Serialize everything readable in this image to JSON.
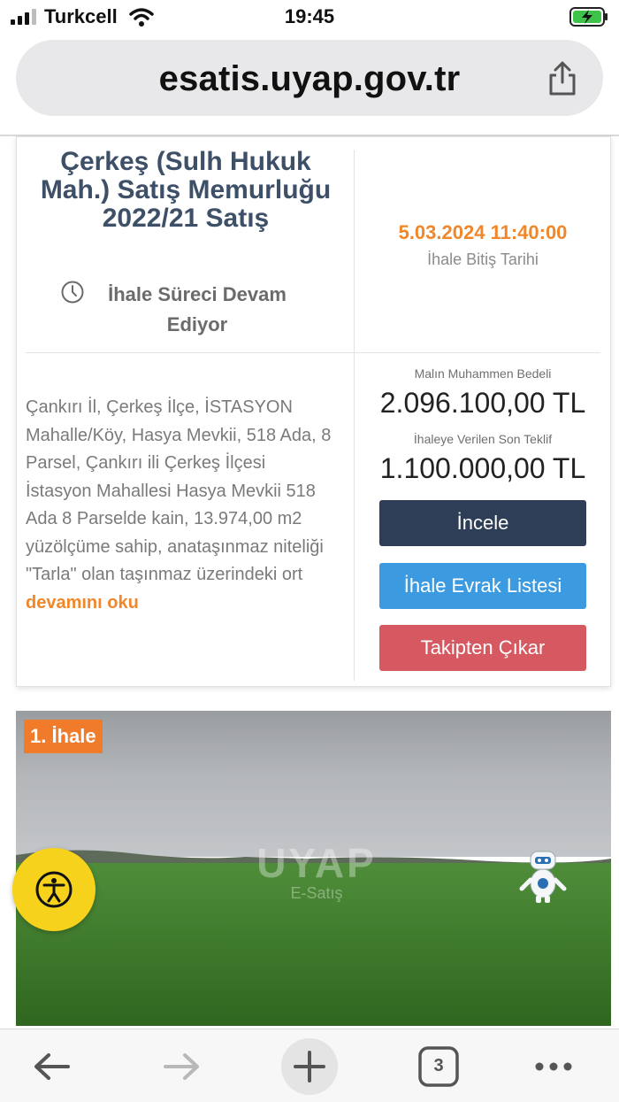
{
  "status_bar": {
    "carrier": "Turkcell",
    "time": "19:45"
  },
  "browser": {
    "url": "esatis.uyap.gov.tr",
    "tab_count": "3"
  },
  "listing": {
    "title": "Çerkeş (Sulh Hukuk Mah.) Satış Memurluğu 2022/21 Satış",
    "status": "İhale Süreci Devam Ediyor",
    "end_date": "5.03.2024 11:40:00",
    "end_date_label": "İhale Bitiş Tarihi",
    "description": "Çankırı İl, Çerkeş İlçe, İSTASYON Mahalle/Köy, Hasya Mevkii, 518 Ada, 8 Parsel, Çankırı ili Çerkeş İlçesi İstasyon Mahallesi Hasya Mevkii 518 Ada 8 Parselde kain, 13.974,00 m2 yüzölçüme sahip, anataşınmaz niteliği \"Tarla\" olan taşınmaz üzerindeki ort",
    "read_more": "devamını oku",
    "appraised_label": "Malın Muhammen Bedeli",
    "appraised_value": "2.096.100,00 TL",
    "last_bid_label": "İhaleye Verilen Son Teklif",
    "last_bid_value": "1.100.000,00 TL",
    "buttons": {
      "inspect": "İncele",
      "documents": "İhale Evrak Listesi",
      "unfollow": "Takipten Çıkar"
    }
  },
  "photo": {
    "badge": "1. İhale",
    "watermark_main": "UYAP",
    "watermark_sub": "E-Satış"
  },
  "colors": {
    "title": "#3d5068",
    "accent_orange": "#f0872a",
    "btn_inspect": "#2e3e56",
    "btn_docs": "#3c9be0",
    "btn_unfollow": "#d65860",
    "a11y_yellow": "#f6d21c"
  },
  "icons": {
    "status_bar": [
      "signal-icon",
      "wifi-icon",
      "battery-charging-icon"
    ],
    "urlbar": "share-icon",
    "status": "clock-icon",
    "fab": "accessibility-icon",
    "toolbar": [
      "back-arrow-icon",
      "forward-arrow-icon",
      "plus-icon",
      "tabs-icon",
      "more-icon"
    ]
  }
}
